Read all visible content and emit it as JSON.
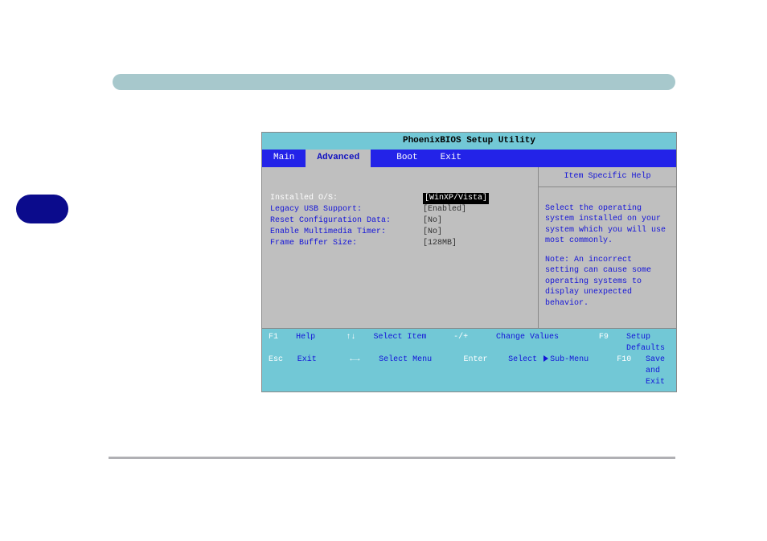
{
  "title": "PhoenixBIOS Setup Utility",
  "tabs": {
    "main": "Main",
    "advanced": "Advanced",
    "boot": "Boot",
    "exit": "Exit"
  },
  "settings": [
    {
      "label": "Installed O/S:",
      "value": "[WinXP/Vista]",
      "selected": true
    },
    {
      "label": "Legacy USB Support:",
      "value": "[Enabled]",
      "selected": false
    },
    {
      "label": "Reset Configuration Data:",
      "value": "[No]",
      "selected": false
    },
    {
      "label": "Enable Multimedia Timer:",
      "value": "[No]",
      "selected": false
    },
    {
      "label": "Frame Buffer Size:",
      "value": "[128MB]",
      "selected": false
    }
  ],
  "help": {
    "title": "Item Specific Help",
    "p1": "Select the operating system installed on your system which you will use most commonly.",
    "p2": "Note: An incorrect setting can cause some operating systems to display unexpected behavior."
  },
  "footer": {
    "r1": {
      "k1": "F1",
      "t1": "Help",
      "a1": "↑↓",
      "t2": "Select Item",
      "k2": "-/+",
      "t3": "Change Values",
      "k3": "F9",
      "t4": "Setup Defaults"
    },
    "r2": {
      "k1": "Esc",
      "t1": "Exit",
      "a1": "←→",
      "t2": "Select Menu",
      "k2": "Enter",
      "t3a": "Select",
      "t3b": "Sub-Menu",
      "k3": "F10",
      "t4": "Save and Exit"
    }
  }
}
